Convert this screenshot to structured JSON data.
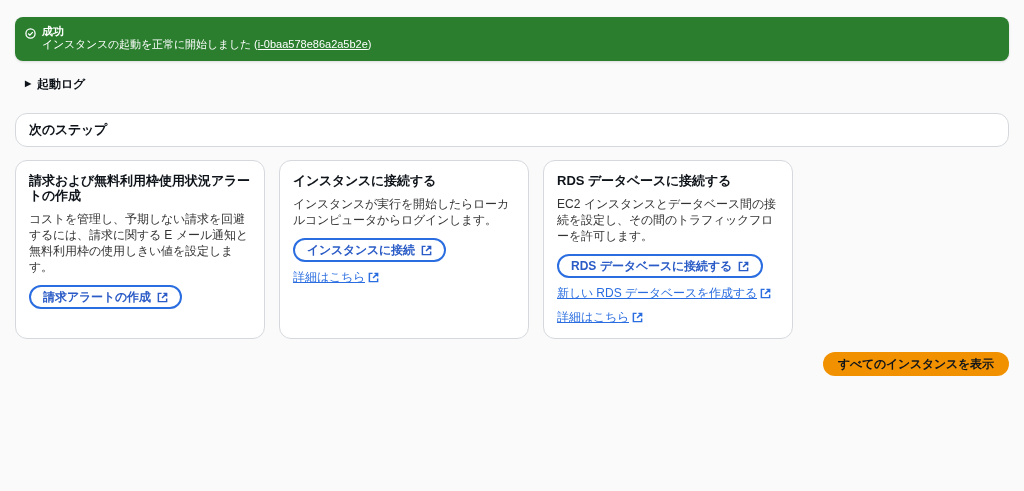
{
  "flash": {
    "title": "成功",
    "message": "インスタンスの起動を正常に開始しました (",
    "link": "i-0baa578e86a2a5b2e",
    "message_end": ")"
  },
  "launch_log": {
    "caret": "▶",
    "label": "起動ログ",
    "expanded": false
  },
  "next_steps": {
    "title": "次のステップ"
  },
  "cards": [
    {
      "title": "請求および無料利用枠使用状況アラートの作成",
      "description": "コストを管理し、予期しない請求を回避するには、請求に関する E メール通知と無料利用枠の使用しきい値を設定します。",
      "button": "請求アラートの作成"
    },
    {
      "title": "インスタンスに接続する",
      "description": "インスタンスが実行を開始したらローカルコンピュータからログインします。",
      "button": "インスタンスに接続",
      "links": [
        "詳細はこちら"
      ]
    },
    {
      "title": "RDS データベースに接続する",
      "description": "EC2 インスタンスとデータベース間の接続を設定し、その間のトラフィックフローを許可します。",
      "button": "RDS データベースに接続する",
      "links": [
        "新しい RDS データベースを作成する",
        "詳細はこちら"
      ]
    }
  ],
  "primary_button": "すべてのインスタンスを表示"
}
